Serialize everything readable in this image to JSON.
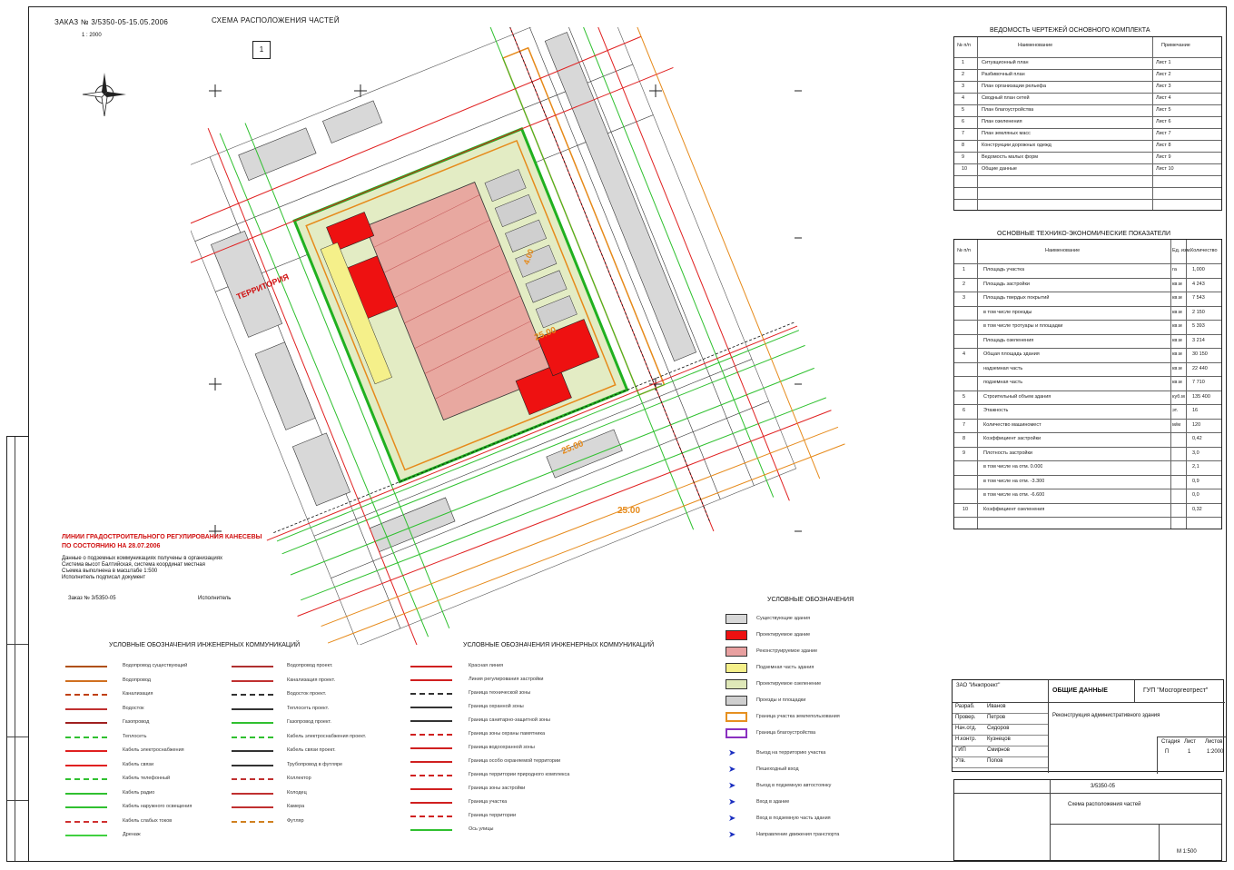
{
  "sheet": {
    "order_header": "ЗАКАЗ № 3/5350-05-15.05.2006",
    "scheme_title": "СХЕМА РАСПОЛОЖЕНИЯ ЧАСТЕЙ",
    "scale_note": "1 : 2000",
    "sheet_mark": "1",
    "north_label": "С"
  },
  "plan": {
    "red_note_line1": "ЛИНИИ ГРАДОСТРОИТЕЛЬНОГО РЕГУЛИРОВАНИЯ КАНЕСЕВЫ",
    "red_note_line2": "ПО СОСТОЯНИЮ НА 28.07.2006",
    "territory_label": "ТЕРРИТОРИЯ",
    "dim_labels": [
      "25.00",
      "25.00",
      "25.00",
      "4.00"
    ],
    "notes": [
      "Данные о подземных коммуникациях получены в организациях",
      "Система высот Балтийская, система координат местная",
      "Съемка выполнена в масштабе 1:500",
      "Исполнитель подписал документ"
    ],
    "sign_left": "Заказ № 3/5350-05",
    "sign_right": "Исполнитель"
  },
  "table1": {
    "title": "ВЕДОМОСТЬ ЧЕРТЕЖЕЙ ОСНОВНОГО КОМПЛЕКТА",
    "headers": [
      "№ п/п",
      "Наименование",
      "Примечание"
    ],
    "rows": [
      [
        "1",
        "Ситуационный план",
        "Лист 1"
      ],
      [
        "2",
        "Разбивочный план",
        "Лист 2"
      ],
      [
        "3",
        "План организации рельефа",
        "Лист 3"
      ],
      [
        "4",
        "Сводный план сетей",
        "Лист 4"
      ],
      [
        "5",
        "План благоустройства",
        "Лист 5"
      ],
      [
        "6",
        "План озеленения",
        "Лист 6"
      ],
      [
        "7",
        "План земляных масс",
        "Лист 7"
      ],
      [
        "8",
        "Конструкции дорожных одежд",
        "Лист 8"
      ],
      [
        "9",
        "Ведомость малых форм",
        "Лист 9"
      ],
      [
        "10",
        "Общие данные",
        "Лист 10"
      ]
    ]
  },
  "table2": {
    "title": "ОСНОВНЫЕ ТЕХНИКО-ЭКОНОМИЧЕСКИЕ ПОКАЗАТЕЛИ",
    "headers": [
      "№ п/п",
      "Наименование",
      "Ед. изм.",
      "Количество"
    ],
    "rows": [
      [
        "1",
        "Площадь участка",
        "га",
        "1,000"
      ],
      [
        "2",
        "Площадь застройки",
        "кв.м",
        "4 243"
      ],
      [
        "3",
        "Площадь твердых покрытий",
        "кв.м",
        "7 543"
      ],
      [
        "",
        "в том числе проезды",
        "кв.м",
        "2 150"
      ],
      [
        "",
        "в том числе тротуары и площадки",
        "кв.м",
        "5 393"
      ],
      [
        "",
        "Площадь озеленения",
        "кв.м",
        "3 214"
      ],
      [
        "4",
        "Общая площадь здания",
        "кв.м",
        "30 150"
      ],
      [
        "",
        "надземная часть",
        "кв.м",
        "22 440"
      ],
      [
        "",
        "подземная часть",
        "кв.м",
        "7 710"
      ],
      [
        "5",
        "Строительный объем здания",
        "куб.м",
        "135 400"
      ],
      [
        "6",
        "Этажность",
        "эт.",
        "16"
      ],
      [
        "7",
        "Количество машиномест",
        "м/м",
        "120"
      ],
      [
        "8",
        "Коэффициент застройки",
        "",
        "0,42"
      ],
      [
        "9",
        "Плотность застройки",
        "",
        "3,0"
      ],
      [
        "",
        "в том числе на отм. 0.000",
        "",
        "2,1"
      ],
      [
        "",
        "в том числе на отм. -3.300",
        "",
        "0,9"
      ],
      [
        "",
        "в том числе на отм. -6.600",
        "",
        "0,0"
      ],
      [
        "10",
        "Коэффициент озеленения",
        "",
        "0,32"
      ]
    ]
  },
  "legend_fill": {
    "title": "УСЛОВНЫЕ ОБОЗНАЧЕНИЯ",
    "items": [
      {
        "label": "Существующие здания",
        "color": "#d8d8d8",
        "border": "#333333"
      },
      {
        "label": "Проектируемое здание",
        "color": "#ee1111",
        "border": "#333333"
      },
      {
        "label": "Реконструируемое здание",
        "color": "#e8a0a0",
        "border": "#333333"
      },
      {
        "label": "Подземная часть здания",
        "color": "#f5f08a",
        "border": "#333333"
      },
      {
        "label": "Проектируемое озеленение",
        "color": "#dfe8b8",
        "border": "#333333"
      },
      {
        "label": "Проезды и площадки",
        "color": "#cfcfcf",
        "border": "#333333"
      },
      {
        "label": "Граница участка землепользования",
        "color": "#ffffff",
        "border": "#e69020"
      },
      {
        "label": "Граница благоустройства",
        "color": "#ffffff",
        "border": "#8a30c0"
      }
    ],
    "arrows": [
      "Въезд на территорию участка",
      "Пешеходный вход",
      "Въезд в подземную автостоянку",
      "Вход в здание",
      "Вход в подземную часть здания",
      "Направление движения транспорта"
    ]
  },
  "legend_lines": {
    "title": "УСЛОВНЫЕ ОБОЗНАЧЕНИЯ ИНЖЕНЕРНЫХ КОММУНИКАЦИЙ",
    "col1": [
      {
        "label": "Водопровод существующий",
        "color": "#b05010"
      },
      {
        "label": "Водопровод",
        "color": "#d07020"
      },
      {
        "label": "Канализация",
        "color": "#c04010"
      },
      {
        "label": "Водосток",
        "color": "#c03030"
      },
      {
        "label": "Газопровод",
        "color": "#a02020"
      },
      {
        "label": "Теплосеть",
        "color": "#30c030"
      },
      {
        "label": "Кабель электроснабжения",
        "color": "#e02020"
      },
      {
        "label": "Кабель связи",
        "color": "#e02020"
      },
      {
        "label": "Кабель телефонный",
        "color": "#30c030"
      },
      {
        "label": "Кабель радио",
        "color": "#30c030"
      },
      {
        "label": "Кабель наружного освещения",
        "color": "#30c030"
      },
      {
        "label": "Кабель слабых токов",
        "color": "#d03030"
      },
      {
        "label": "Дренаж",
        "color": "#40d040"
      }
    ],
    "col2": [
      {
        "label": "Водопровод проект.",
        "color": "#b03030"
      },
      {
        "label": "Канализация проект.",
        "color": "#c03030"
      },
      {
        "label": "Водосток проект.",
        "color": "#333333"
      },
      {
        "label": "Теплосеть проект.",
        "color": "#333333"
      },
      {
        "label": "Газопровод проект.",
        "color": "#30c030"
      },
      {
        "label": "Кабель электроснабжения проект.",
        "color": "#30c030"
      },
      {
        "label": "Кабель связи проект.",
        "color": "#333333"
      },
      {
        "label": "Трубопровод в футляре",
        "color": "#333333"
      },
      {
        "label": "Коллектор",
        "color": "#c03030"
      },
      {
        "label": "Колодец",
        "color": "#c03030"
      },
      {
        "label": "Камера",
        "color": "#c03030"
      },
      {
        "label": "Футляр",
        "color": "#d08020"
      }
    ],
    "col3": [
      {
        "label": "Красная линия",
        "color": "#d02020"
      },
      {
        "label": "Линия регулирования застройки",
        "color": "#d02020"
      },
      {
        "label": "Граница технической зоны",
        "color": "#333333"
      },
      {
        "label": "Граница охранной зоны",
        "color": "#333333"
      },
      {
        "label": "Граница санитарно-защитной зоны",
        "color": "#333333"
      },
      {
        "label": "Граница зоны охраны памятника",
        "color": "#d02020"
      },
      {
        "label": "Граница водоохранной зоны",
        "color": "#d02020"
      },
      {
        "label": "Граница особо охраняемой территории",
        "color": "#d02020"
      },
      {
        "label": "Граница территории природного комплекса",
        "color": "#d02020"
      },
      {
        "label": "Граница зоны застройки",
        "color": "#d02020"
      },
      {
        "label": "Граница участка",
        "color": "#d02020"
      },
      {
        "label": "Граница территории",
        "color": "#d02020"
      },
      {
        "label": "Ось улицы",
        "color": "#30c030"
      }
    ]
  },
  "stamp": {
    "org": "ЗАО \"Инжпроект\"",
    "center_label": "ОБЩИЕ ДАННЫЕ",
    "right_label": "ГУП \"Мосгоргеотрест\"",
    "object": "Реконструкция административного здания",
    "stage": "Стадия",
    "sheet": "Лист",
    "sheets": "Листов",
    "stage_val": "П",
    "sheet_val": "1",
    "sheets_val": "1",
    "scale": "1:2000",
    "roles": [
      "Разраб.",
      "Провер.",
      "Нач.отд.",
      "Н.контр.",
      "ГИП",
      "Утв."
    ],
    "names": [
      "Иванов",
      "Петров",
      "Сидоров",
      "Кузнецов",
      "Смирнов",
      "Попов"
    ],
    "bottom_title": "Схема расположения частей",
    "bottom_num": "3/5350-05",
    "bottom_code": "М 1:500"
  }
}
